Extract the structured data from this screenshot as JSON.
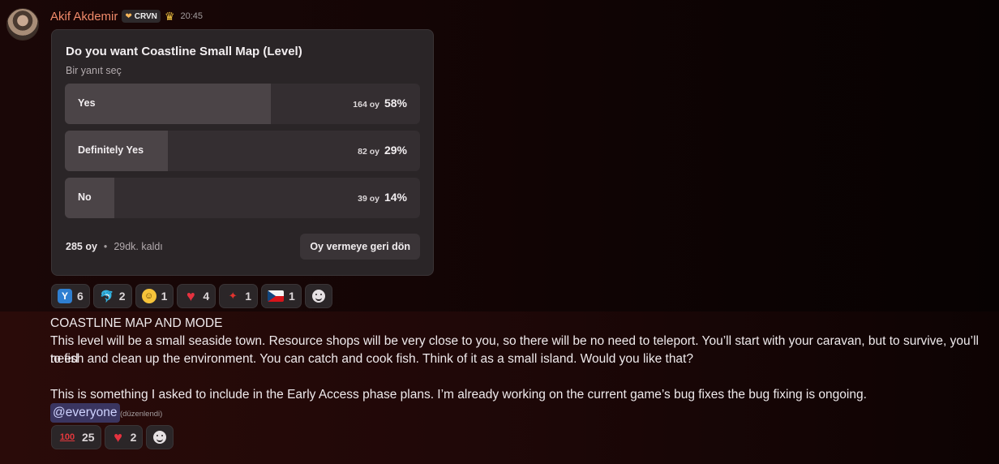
{
  "message": {
    "author": "Akif Akdemir",
    "tag": "CRVN",
    "time": "20:45"
  },
  "poll": {
    "question": "Do you want Coastline Small Map (Level)",
    "hint": "Bir yanıt seç",
    "options": [
      {
        "label": "Yes",
        "votes": "164 oy",
        "percent": "58%",
        "fraction": 0.58
      },
      {
        "label": "Definitely Yes",
        "votes": "82 oy",
        "percent": "29%",
        "fraction": 0.29
      },
      {
        "label": "No",
        "votes": "39 oy",
        "percent": "14%",
        "fraction": 0.14
      }
    ],
    "total_votes": "285 oy",
    "separator": "•",
    "time_left": "29dk. kaldı",
    "back_button": "Oy vermeye geri dön"
  },
  "poll_reactions": [
    {
      "emoji": "y-letter-icon",
      "count": "6"
    },
    {
      "emoji": "dolphin-icon",
      "count": "2"
    },
    {
      "emoji": "smiley-icon",
      "count": "1"
    },
    {
      "emoji": "heart-icon",
      "count": "4"
    },
    {
      "emoji": "maple-leaf-icon",
      "count": "1"
    },
    {
      "emoji": "czech-flag-icon",
      "count": "1"
    }
  ],
  "post": {
    "heading": "COASTLINE MAP AND MODE",
    "line1": "This level will be a small seaside town. Resource shops will be very close to you, so there will be no need to teleport. You’ll start with your caravan, but to survive, you’ll need",
    "line2": "to fish and clean up the environment. You can catch and cook fish. Think of it as a small island. Would you like that?",
    "line3": "This is something I asked to include in the Early Access phase plans. I’m already working on the current game’s bug fixes  the bug fixing is ongoing.",
    "mention": "@everyone",
    "edited": "(düzenlendi)"
  },
  "post_reactions": [
    {
      "emoji": "hundred-points-icon",
      "count": "25"
    },
    {
      "emoji": "heart-icon",
      "count": "2"
    }
  ],
  "colors": {
    "username": "#f08a6a",
    "poll_bg": "#2a2527",
    "mention_bg": "#3a3560"
  }
}
